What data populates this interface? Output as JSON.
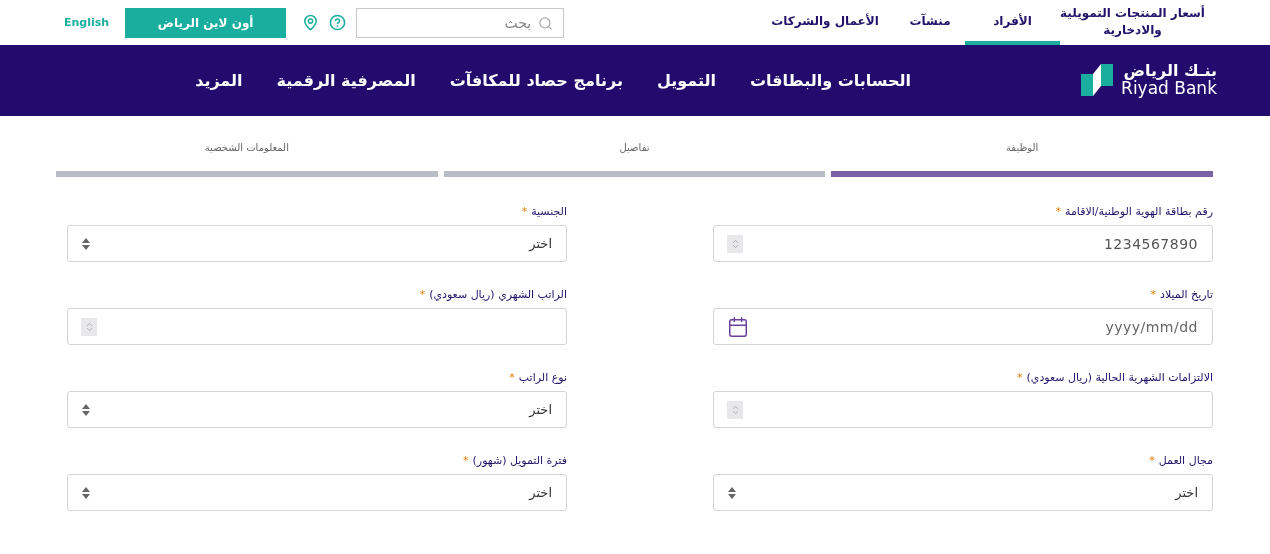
{
  "top_bar": {
    "tabs": [
      {
        "label": "أسعار المنتجات التمويلية والادخارية",
        "selected": false
      },
      {
        "label": "الأفراد",
        "selected": true
      },
      {
        "label": "منشآت",
        "selected": false
      },
      {
        "label": "الأعمال والشركات",
        "selected": false
      }
    ],
    "search": {
      "placeholder": "بحث"
    },
    "online_button": "أون لاين الرياض",
    "language_link": "English"
  },
  "nav": {
    "logo": {
      "arabic": "بنـك الرياض",
      "english": "Riyad Bank"
    },
    "items": [
      "الحسابات والبطاقات",
      "التمويل",
      "برنامج حصاد للمكافآت",
      "المصرفية الرقمية",
      "المزيد"
    ]
  },
  "steps": [
    {
      "label": "الوظيفة",
      "selected": true
    },
    {
      "label": "تفاصيل",
      "selected": false
    },
    {
      "label": "المعلومات الشخصية",
      "selected": false
    }
  ],
  "fields": [
    {
      "kind": "number",
      "label": "رقم بطاقة الهوية الوطنية/الاقامة",
      "required_mark": "*",
      "value": "1234567890"
    },
    {
      "kind": "select",
      "label": "الجنسية",
      "required_mark": "*",
      "value": "اختر"
    },
    {
      "kind": "date",
      "label": "تاريخ الميلاد",
      "required_mark": "*",
      "placeholder": "yyyy/mm/dd"
    },
    {
      "kind": "number",
      "label": "الراتب الشهري (ريال سعودي)",
      "required_mark": "*"
    },
    {
      "kind": "number",
      "label": "الالتزامات الشهرية الحالية (ريال سعودي)",
      "required_mark": "*"
    },
    {
      "kind": "select",
      "label": "نوع الراتب",
      "required_mark": "*",
      "value": "اختر"
    },
    {
      "kind": "select",
      "label": "مجال العمل",
      "required_mark": "*",
      "value": "اختر"
    },
    {
      "kind": "select",
      "label": "فترة التمويل (شهور)",
      "required_mark": "*",
      "value": "اختر"
    }
  ]
}
